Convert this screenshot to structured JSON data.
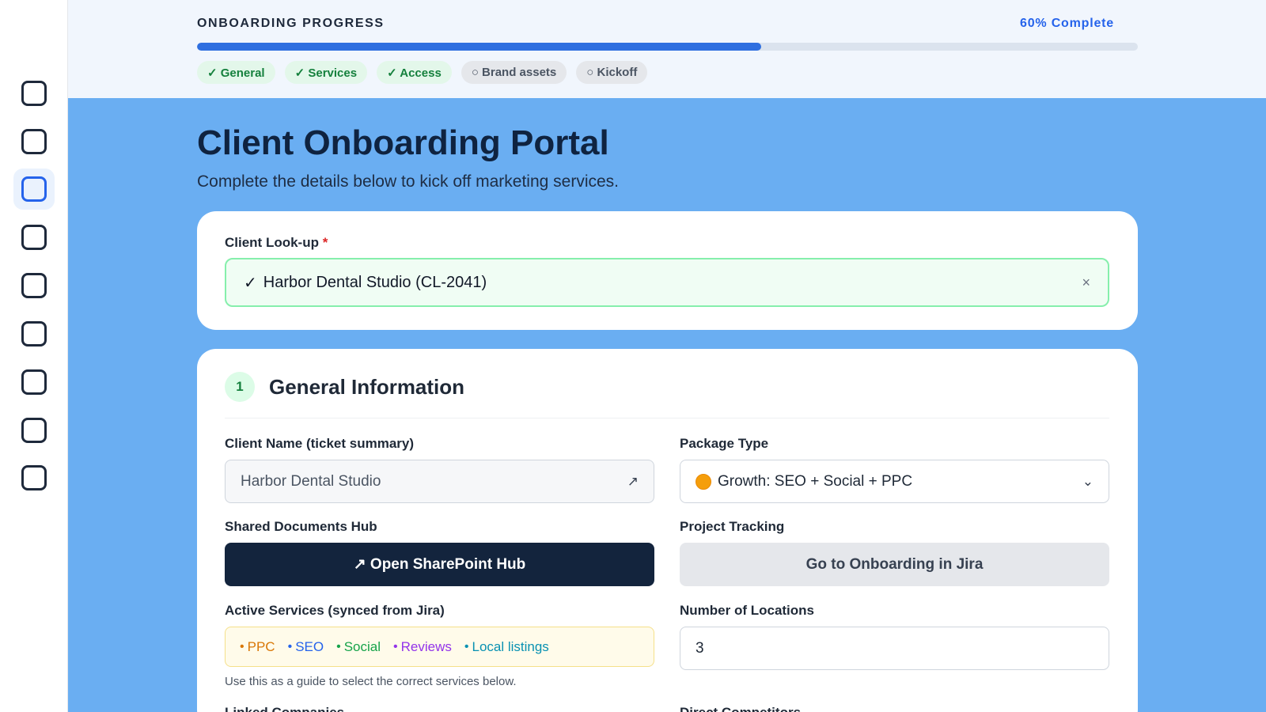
{
  "sidebar": {
    "items": [
      {
        "icon": "square-icon",
        "active": false
      },
      {
        "icon": "square-icon",
        "active": false
      },
      {
        "icon": "square-icon",
        "active": true
      },
      {
        "icon": "square-icon",
        "active": false
      },
      {
        "icon": "square-icon",
        "active": false
      },
      {
        "icon": "square-icon",
        "active": false
      },
      {
        "icon": "square-icon",
        "active": false
      },
      {
        "icon": "square-icon",
        "active": false
      },
      {
        "icon": "square-icon",
        "active": false
      }
    ]
  },
  "progress": {
    "title": "ONBOARDING PROGRESS",
    "percent_label": "60% Complete",
    "percent_value": 0.6,
    "steps": [
      {
        "label": "✓ General",
        "status": "done"
      },
      {
        "label": "✓ Services",
        "status": "done"
      },
      {
        "label": "✓ Access",
        "status": "done"
      },
      {
        "label": "○ Brand assets",
        "status": "todo"
      },
      {
        "label": "○ Kickoff",
        "status": "todo"
      }
    ]
  },
  "page": {
    "title": "Client Onboarding Portal",
    "subtitle": "Complete the details below to kick off marketing services."
  },
  "lookup": {
    "label": "Client Look-up",
    "required_mark": "*",
    "check": "✓",
    "value": "Harbor Dental Studio (CL-2041)",
    "clear_icon": "×"
  },
  "general": {
    "number": "1",
    "title": "General Information",
    "client_name": {
      "label": "Client Name (ticket summary)",
      "value": "Harbor Dental Studio",
      "link_icon": "↗"
    },
    "package_type": {
      "label": "Package Type",
      "value": "Growth: SEO + Social + PPC",
      "chevron": "⌄"
    },
    "documents": {
      "label": "Shared Documents Hub",
      "button": "↗ Open SharePoint Hub"
    },
    "tracking": {
      "label": "Project Tracking",
      "button": "Go to Onboarding in Jira"
    },
    "active_services": {
      "label": "Active Services (synced from Jira)",
      "items": [
        {
          "label": "PPC",
          "color": "#d97706"
        },
        {
          "label": "SEO",
          "color": "#2563eb"
        },
        {
          "label": "Social",
          "color": "#16a34a"
        },
        {
          "label": "Reviews",
          "color": "#9333ea"
        },
        {
          "label": "Local listings",
          "color": "#0891b2"
        }
      ],
      "hint": "Use this as a guide to select the correct services below."
    },
    "locations": {
      "label": "Number of Locations",
      "value": "3"
    },
    "linked_companies": {
      "label": "Linked Companies"
    },
    "direct_competitors": {
      "label": "Direct Competitors"
    }
  },
  "colors": {
    "accent": "#2563eb",
    "background": "#6aaef2",
    "dark_button": "#13243d"
  }
}
